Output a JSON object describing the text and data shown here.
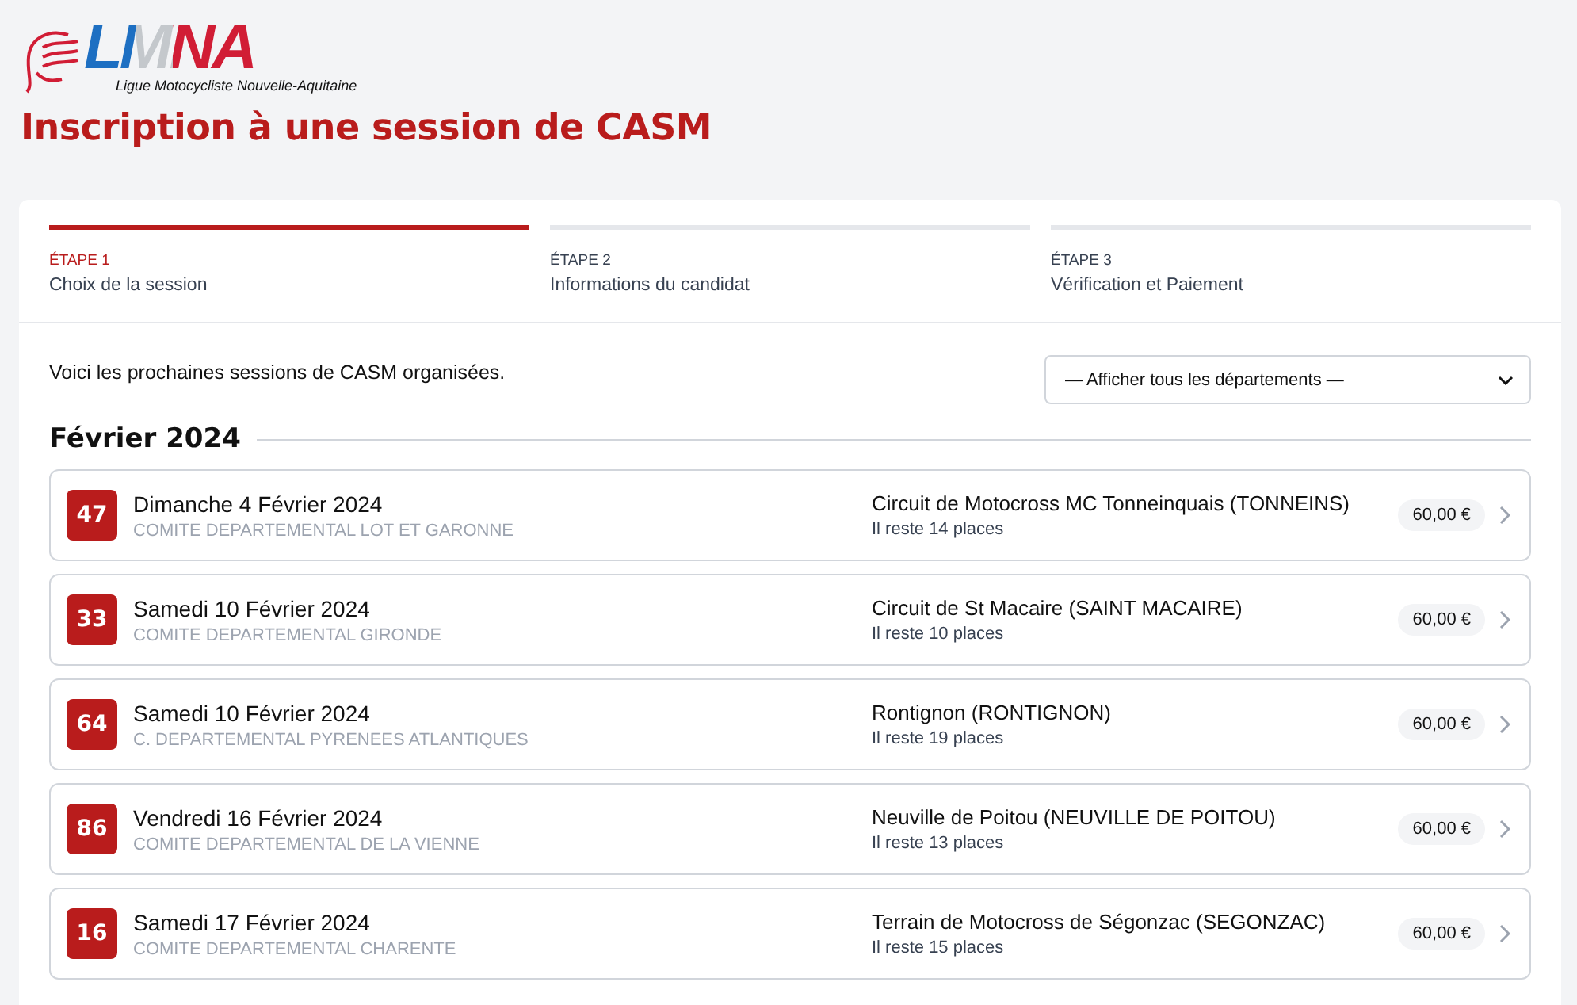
{
  "logo": {
    "letters": "LMNA",
    "tagline": "Ligue Motocycliste Nouvelle-Aquitaine"
  },
  "title": "Inscription à une session de CASM",
  "steps": [
    {
      "label": "ÉTAPE 1",
      "name": "Choix de la session",
      "selected": true
    },
    {
      "label": "ÉTAPE 2",
      "name": "Informations du candidat",
      "selected": false
    },
    {
      "label": "ÉTAPE 3",
      "name": "Vérification et Paiement",
      "selected": false
    }
  ],
  "intro": "Voici les prochaines sessions de CASM organisées.",
  "filter": {
    "value": "— Afficher tous les départements —"
  },
  "month": "Février 2024",
  "sessions": [
    {
      "dept": "47",
      "date": "Dimanche 4 Février 2024",
      "committee": "COMITE DEPARTEMENTAL LOT ET GARONNE",
      "place": "Circuit de Motocross MC Tonneinquais (TONNEINS)",
      "remaining": "Il reste 14 places",
      "price": "60,00 €"
    },
    {
      "dept": "33",
      "date": "Samedi 10 Février 2024",
      "committee": "COMITE DEPARTEMENTAL GIRONDE",
      "place": "Circuit de St Macaire (SAINT MACAIRE)",
      "remaining": "Il reste 10 places",
      "price": "60,00 €"
    },
    {
      "dept": "64",
      "date": "Samedi 10 Février 2024",
      "committee": "C. DEPARTEMENTAL PYRENEES ATLANTIQUES",
      "place": "Rontignon (RONTIGNON)",
      "remaining": "Il reste 19 places",
      "price": "60,00 €"
    },
    {
      "dept": "86",
      "date": "Vendredi 16 Février 2024",
      "committee": "COMITE DEPARTEMENTAL DE LA VIENNE",
      "place": "Neuville de Poitou (NEUVILLE DE POITOU)",
      "remaining": "Il reste 13 places",
      "price": "60,00 €"
    },
    {
      "dept": "16",
      "date": "Samedi 17 Février 2024",
      "committee": "COMITE DEPARTEMENTAL CHARENTE",
      "place": "Terrain de Motocross de Ségonzac (SEGONZAC)",
      "remaining": "Il reste 15 places",
      "price": "60,00 €"
    }
  ]
}
